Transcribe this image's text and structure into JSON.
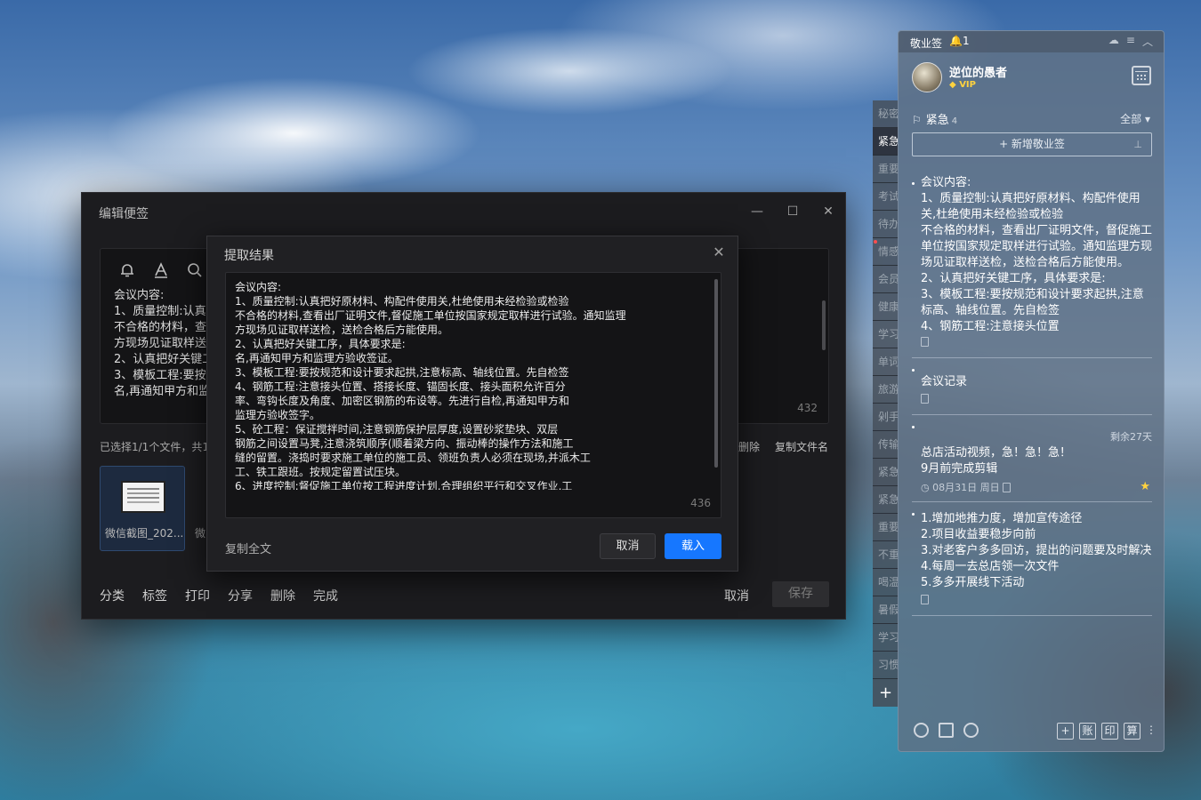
{
  "edit_window": {
    "title": "编辑便签",
    "min": "—",
    "max": "☐",
    "close": "✕",
    "text": "会议内容:\n1、质量控制:认真\n不合格的材料，查\n方现场见证取样送\n2、认真把好关键工\n3、模板工程:要按\n名,再通知甲方和监",
    "char_count": "432",
    "file_info": "已选择1/1个文件，共1",
    "file_delete": "删除",
    "file_copy_name": "复制文件名",
    "file_name": "微信截图_202...",
    "file_name_2": "微",
    "bottom_actions": [
      "分类",
      "标签",
      "打印",
      "分享",
      "删除",
      "完成"
    ],
    "cancel": "取消",
    "save": "保存"
  },
  "extract_dialog": {
    "title": "提取结果",
    "close": "✕",
    "text": "会议内容:\n1、质量控制:认真把好原材料、构配件使用关,杜绝使用未经检验或检验\n不合格的材料,查看出厂证明文件,督促施工单位按国家规定取样进行试验。通知监理\n方现场见证取样送检，送检合格后方能使用。\n2、认真把好关键工序，具体要求是:\n名,再通知甲方和监理方验收签证。\n3、模板工程:要按规范和设计要求起拱,注意标高、轴线位置。先自检签\n4、钢筋工程:注意接头位置、搭接长度、锚固长度、接头面积允许百分\n率、弯钩长度及角度、加密区钢筋的布设等。先进行自检,再通知甲方和\n监理方验收签字。\n5、砼工程：保证搅拌时间,注意钢筋保护层厚度,设置砂浆垫块、双层\n钢筋之间设置马凳,注意浇筑顺序(顺着梁方向、振动棒的操作方法和施工\n缝的留置。浇捣时要求施工单位的施工员、领班负责人必须在现场,并派木工\n工、铁工跟班。按规定留置试压块。\n6、进度控制:督促施工单位按工程进度计划,合理组织平行和交叉作业,工",
    "char_count": "436",
    "copy_all": "复制全文",
    "cancel": "取消",
    "load": "载入"
  },
  "side_tabs": [
    {
      "label": "秘密",
      "active": false,
      "dot": false
    },
    {
      "label": "紧急",
      "active": true,
      "dot": false
    },
    {
      "label": "重要",
      "active": false,
      "dot": false
    },
    {
      "label": "考试",
      "active": false,
      "dot": false
    },
    {
      "label": "待办",
      "active": false,
      "dot": false
    },
    {
      "label": "情感",
      "active": false,
      "dot": true
    },
    {
      "label": "会员",
      "active": false,
      "dot": false
    },
    {
      "label": "健康",
      "active": false,
      "dot": false
    },
    {
      "label": "学习",
      "active": false,
      "dot": false
    },
    {
      "label": "单词",
      "active": false,
      "dot": false
    },
    {
      "label": "旅游",
      "active": false,
      "dot": false
    },
    {
      "label": "剁手",
      "active": false,
      "dot": false
    },
    {
      "label": "传输",
      "active": false,
      "dot": false
    },
    {
      "label": "紧急",
      "active": false,
      "dot": false
    },
    {
      "label": "紧急",
      "active": false,
      "dot": false
    },
    {
      "label": "重要",
      "active": false,
      "dot": false
    },
    {
      "label": "不重",
      "active": false,
      "dot": false
    },
    {
      "label": "喝温",
      "active": false,
      "dot": false
    },
    {
      "label": "暑假",
      "active": false,
      "dot": false
    },
    {
      "label": "学习",
      "active": false,
      "dot": false
    },
    {
      "label": "习惯",
      "active": false,
      "dot": false
    }
  ],
  "side_add": "+",
  "panel": {
    "app_name": "敬业签",
    "notif_count": "1",
    "username": "逆位的愚者",
    "vip": "VIP",
    "category": "紧急",
    "category_count": "4",
    "filter": "全部 ▾",
    "new_note": "+ 新增敬业签",
    "notes": [
      {
        "text": "会议内容:\n1、质量控制:认真把好原材料、构配件使用关,杜绝使用未经检验或检验\n不合格的材料，查看出厂证明文件，督促施工单位按国家规定取样进行试验。通知监理方现场见证取样送检，送检合格后方能使用。\n2、认真把好关键工序，具体要求是:\n3、模板工程:要按规范和设计要求起拱,注意标高、轴线位置。先自检签\n4、钢筋工程:注意接头位置"
      },
      {
        "text": "会议记录"
      },
      {
        "text": "总店活动视频，急！急！急！\n9月前完成剪辑",
        "remain": "剩余27天",
        "date": "08月31日 周日"
      },
      {
        "text": "1.增加地推力度，增加宣传途径\n2.项目收益要稳步向前\n3.对老客户多多回访，提出的问题要及时解决\n4.每周一去总店领一次文件\n5.多多开展线下活动"
      }
    ],
    "footer_buttons": [
      "+",
      "账",
      "印",
      "算"
    ]
  }
}
